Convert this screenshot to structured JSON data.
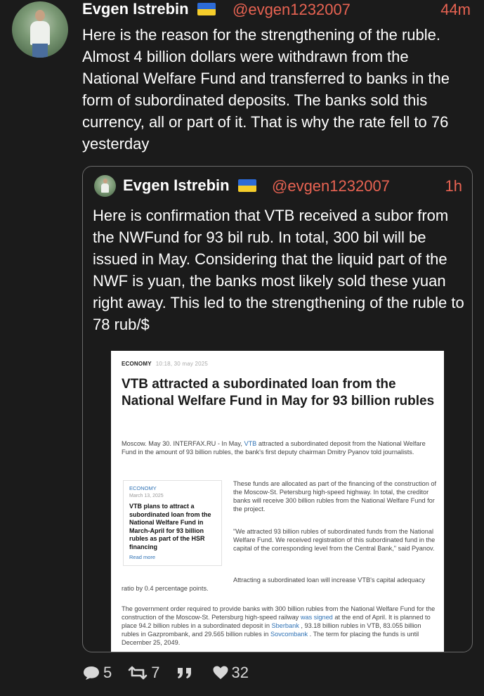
{
  "tweet": {
    "author_name": "Evgen Istrebin",
    "flag": "ukraine-flag",
    "handle": "@evgen1232007",
    "time": "44m",
    "text": "Here is the reason for the strengthening of the ruble. Almost 4 billion dollars were withdrawn from the National Welfare Fund and transferred to banks in the form of subordinated deposits. The banks sold this currency, all or part of it. That is why the rate fell to 76 yesterday"
  },
  "quote": {
    "author_name": "Evgen Istrebin",
    "handle": "@evgen1232007",
    "time": "1h",
    "text": "Here is confirmation that VTB received a subor from the NWFund for 93 bil rub. In total, 300 bil will be issued in May. Considering that the liquid part of the NWF is yuan, the banks most likely sold these yuan right away. This led to the strengthening of the ruble to 78 rub/$"
  },
  "article": {
    "section": "ECONOMY",
    "datetime": "10:18, 30 may 2025",
    "title": "VTB attracted a subordinated loan from the National Welfare Fund in May for 93 billion rubles",
    "lead_before": "Moscow. May 30. INTERFAX.RU - In May, ",
    "lead_link": "VTB",
    "lead_after": " attracted a subordinated deposit from the National Welfare Fund in the amount of 93 billion rubles, the bank's first deputy chairman Dmitry Pyanov told journalists.",
    "sidebar": {
      "category": "ECONOMY",
      "date": "March 13, 2025",
      "title": "VTB plans to attract a subordinated loan from the National Welfare Fund in March-April for 93 billion rubles as part of the HSR financing",
      "read_more": "Read more"
    },
    "para2": "These funds are allocated as part of the financing of the construction of the Moscow-St. Petersburg high-speed highway. In total, the creditor banks will receive 300 billion rubles from the National Welfare Fund for the project.",
    "para3": "\"We attracted 93 billion rubles of subordinated funds from the National Welfare Fund. We received registration of this subordinated fund in the capital of the corresponding level from the Central Bank,\" said Pyanov.",
    "para4": "Attracting a subordinated loan will increase VTB's capital adequacy ratio by 0.4 percentage points.",
    "para5_a": "The government order required to provide banks with 300 billion rubles from the National Welfare Fund for the construction of the Moscow-St. Petersburg high-speed railway ",
    "para5_link1": "was signed",
    "para5_b": " at the end of April. It is planned to place 94.2 billion rubles in a subordinated deposit in ",
    "para5_link2": "Sberbank",
    "para5_c": " , 93.18 billion rubles in VTB, 83.055 billion rubles in Gazprombank, and 29.565 billion rubles in ",
    "para5_link3": "Sovcombank",
    "para5_d": " . The term for placing the funds is until December 25, 2049."
  },
  "actions": {
    "replies": "5",
    "retweets": "7",
    "likes": "32"
  },
  "colors": {
    "background": "#1b1b1b",
    "accent": "#e86352",
    "link": "#2f72b5"
  }
}
